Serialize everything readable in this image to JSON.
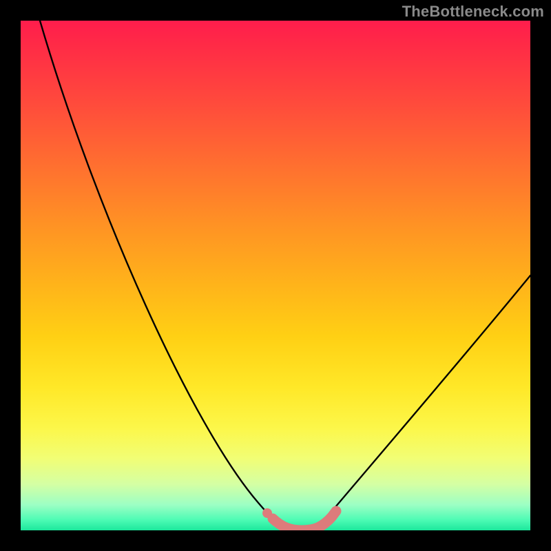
{
  "watermark": "TheBottleneck.com",
  "chart_data": {
    "type": "line",
    "title": "",
    "xlabel": "",
    "ylabel": "",
    "xlim": [
      0,
      100
    ],
    "ylim": [
      0,
      100
    ],
    "series": [
      {
        "name": "bottleneck-curve",
        "x": [
          4,
          8,
          12,
          16,
          20,
          24,
          28,
          32,
          36,
          40,
          44,
          48,
          50,
          52,
          54,
          56,
          58,
          60,
          64,
          70,
          76,
          82,
          88,
          94,
          100
        ],
        "values": [
          100,
          91,
          83,
          75,
          67,
          59,
          51,
          43,
          35,
          27,
          19,
          11,
          6,
          3,
          1,
          0,
          0,
          1,
          5,
          11,
          19,
          27,
          35,
          43,
          51
        ]
      },
      {
        "name": "highlight-band",
        "x": [
          49,
          51,
          53,
          55,
          57,
          59,
          61
        ],
        "values": [
          4,
          2,
          0.5,
          0,
          0,
          0.5,
          2
        ]
      }
    ],
    "colors": {
      "curve": "#000000",
      "highlight": "#DD7B7B",
      "gradient_top": "#FF1D4C",
      "gradient_bottom": "#1CE79C"
    }
  }
}
